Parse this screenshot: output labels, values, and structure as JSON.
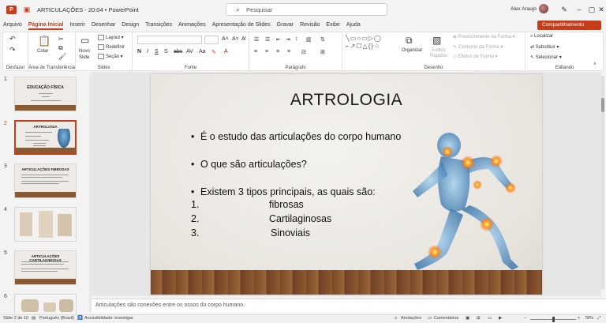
{
  "window": {
    "doc_title": "ARTICULAÇÕES - 20:04",
    "app_sep": "•",
    "app_name": "PowerPoint",
    "search_placeholder": "Pesquisar",
    "user_name": "Alex Araujo",
    "share_label": "Compartilhamento"
  },
  "menu": {
    "tabs": [
      "Arquivo",
      "Página Inicial",
      "Inserir",
      "Desenhar",
      "Design",
      "Transições",
      "Animações",
      "Apresentação de Slides",
      "Gravar",
      "Revisão",
      "Exibir",
      "Ajuda"
    ],
    "active": 1
  },
  "ribbon": {
    "undo_label": "Desfazer",
    "clipboard": {
      "paste": "Colar",
      "label": "Área de Transferência"
    },
    "slides": {
      "new_slide": "Novo Slide",
      "layout": "Layout",
      "reset": "Redefinir",
      "section": "Seção",
      "label": "Slides"
    },
    "font": {
      "label": "Fonte"
    },
    "paragraph": {
      "label": "Parágrafo"
    },
    "drawing": {
      "arrange": "Organizar",
      "quick_styles": "Estilos Rápidos",
      "fill": "Preenchimento da Forma",
      "outline": "Contorno da Forma",
      "effects": "Efeitos de Forma",
      "label": "Desenho"
    },
    "editing": {
      "find": "Localizar",
      "replace": "Substituir",
      "select": "Selecionar",
      "label": "Editando"
    }
  },
  "thumbnails": [
    {
      "num": "1",
      "title": "EDUCAÇÃO FÍSICA"
    },
    {
      "num": "2",
      "title": "ARTROLOGIA"
    },
    {
      "num": "3",
      "title": "ARTICULAÇÕES FIBROSAS"
    },
    {
      "num": "4",
      "title": ""
    },
    {
      "num": "5",
      "title": "ARTICULAÇÕES CARTILAGINOSAS"
    },
    {
      "num": "6",
      "title": ""
    }
  ],
  "selected_slide": 2,
  "slide": {
    "title": "ARTROLOGIA",
    "bullets": [
      "É o estudo das articulações do corpo humano",
      "O que são articulações?",
      "Existem 3 tipos principais, as quais são:"
    ],
    "types": [
      {
        "num": "1.",
        "name": "fibrosas"
      },
      {
        "num": "2.",
        "name": "Cartilaginosas"
      },
      {
        "num": "3.",
        "name": "Sinoviais"
      }
    ]
  },
  "notes": "Articulações são conexões entre os ossos do corpo humano.",
  "status": {
    "slide_pos": "Slide 2 de 10",
    "language": "Português (Brasil)",
    "accessibility": "Acessibilidade: investigar",
    "notes_btn": "Anotações",
    "comments_btn": "Comentários",
    "zoom": "78%"
  },
  "colors": {
    "accent": "#c43e1c",
    "floor": "#8b5a33"
  }
}
